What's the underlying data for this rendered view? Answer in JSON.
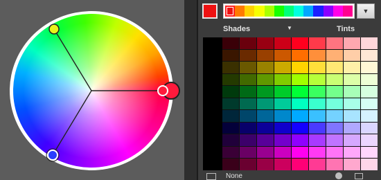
{
  "wheel": {
    "handles": [
      {
        "name": "base-color",
        "color": "#ff1a3c"
      },
      {
        "name": "harmony-color-1",
        "color": "#e8f21a"
      },
      {
        "name": "harmony-color-2",
        "color": "#2a3cff"
      }
    ]
  },
  "swatch_panel": {
    "current_color": "#ee1111",
    "strip_colors": [
      "#ee1111",
      "#ff7a00",
      "#ffd200",
      "#f8ff00",
      "#aaff00",
      "#18ff00",
      "#00ff7a",
      "#00ffe0",
      "#00a8ff",
      "#1a20ff",
      "#8a00ff",
      "#ff00e8",
      "#ff0090"
    ],
    "strip_selected_index": 0,
    "shades_label": "Shades",
    "tints_label": "Tints",
    "bottom_label": "None",
    "grid": [
      [
        "#3a0008",
        "#6a000d",
        "#990012",
        "#cc0018",
        "#ff001e",
        "#ff3a4a",
        "#ff7480",
        "#ffa8b0",
        "#ffd6da"
      ],
      [
        "#3a1600",
        "#6a2a00",
        "#994000",
        "#cc5800",
        "#ff6e00",
        "#ff8f3a",
        "#ffb074",
        "#ffcea8",
        "#ffe8d6"
      ],
      [
        "#3a3000",
        "#6a5800",
        "#998200",
        "#ccaa00",
        "#ffd400",
        "#ffde3a",
        "#ffe874",
        "#fff0a8",
        "#fff8d6"
      ],
      [
        "#243a00",
        "#426a00",
        "#609900",
        "#80cc00",
        "#a0ff00",
        "#b6ff3a",
        "#caff74",
        "#ddffa8",
        "#eeffd6"
      ],
      [
        "#003a0c",
        "#006a16",
        "#009920",
        "#00cc2a",
        "#00ff36",
        "#3aff60",
        "#74ff8c",
        "#a8ffb8",
        "#d6ffe0"
      ],
      [
        "#003a2c",
        "#006a50",
        "#009974",
        "#00cc9a",
        "#00ffc0",
        "#3affce",
        "#74ffdc",
        "#a8ffe8",
        "#d6fff4"
      ],
      [
        "#00263a",
        "#00466a",
        "#006699",
        "#0088cc",
        "#00aaff",
        "#3ac0ff",
        "#74d2ff",
        "#a8e4ff",
        "#d6f2ff"
      ],
      [
        "#04003a",
        "#08006a",
        "#0c0099",
        "#1000cc",
        "#1400ff",
        "#4a3aff",
        "#8074ff",
        "#b0a8ff",
        "#dad6ff"
      ],
      [
        "#20003a",
        "#3c006a",
        "#580099",
        "#7400cc",
        "#9000ff",
        "#a83aff",
        "#c074ff",
        "#d6a8ff",
        "#ecd6ff"
      ],
      [
        "#3a0036",
        "#6a0064",
        "#990090",
        "#cc00c0",
        "#ff00f0",
        "#ff3af4",
        "#ff74f6",
        "#ffa8fa",
        "#ffd6fc"
      ],
      [
        "#3a001a",
        "#6a0030",
        "#990046",
        "#cc005e",
        "#ff0076",
        "#ff3a94",
        "#ff74b2",
        "#ffa8ce",
        "#ffd6e8"
      ]
    ]
  }
}
